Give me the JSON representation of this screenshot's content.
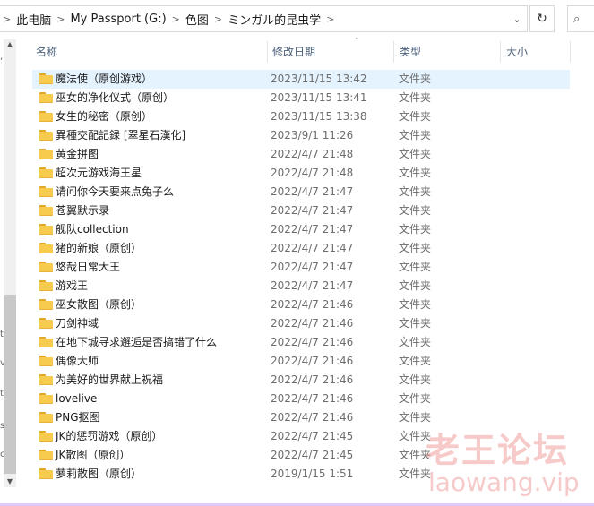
{
  "address_bar": {
    "crumbs": [
      "此电脑",
      "My Passport (G:)",
      "色图",
      "ミンガル的昆虫学"
    ],
    "separator": ">",
    "dropdown_glyph": "⌄",
    "refresh_glyph": "↻",
    "search_glyph": "⌕"
  },
  "columns": {
    "name": "名称",
    "date": "修改日期",
    "type": "类型",
    "size": "大小",
    "sort_glyph": "ˇ"
  },
  "files": [
    {
      "name": "魔法使（原创游戏）",
      "date": "2023/11/15 13:42",
      "type": "文件夹"
    },
    {
      "name": "巫女的净化仪式（原创）",
      "date": "2023/11/15 13:41",
      "type": "文件夹"
    },
    {
      "name": "女生的秘密（原创）",
      "date": "2023/11/15 13:38",
      "type": "文件夹"
    },
    {
      "name": "異種交配記録 [翠星石漢化]",
      "date": "2023/9/1 11:26",
      "type": "文件夹"
    },
    {
      "name": "黄金拼图",
      "date": "2022/4/7 21:48",
      "type": "文件夹"
    },
    {
      "name": "超次元游戏海王星",
      "date": "2022/4/7 21:48",
      "type": "文件夹"
    },
    {
      "name": "请问你今天要来点兔子么",
      "date": "2022/4/7 21:47",
      "type": "文件夹"
    },
    {
      "name": "苍翼默示录",
      "date": "2022/4/7 21:47",
      "type": "文件夹"
    },
    {
      "name": "舰队collection",
      "date": "2022/4/7 21:47",
      "type": "文件夹"
    },
    {
      "name": "猪的新娘（原创）",
      "date": "2022/4/7 21:47",
      "type": "文件夹"
    },
    {
      "name": "悠哉日常大王",
      "date": "2022/4/7 21:47",
      "type": "文件夹"
    },
    {
      "name": "游戏王",
      "date": "2022/4/7 21:47",
      "type": "文件夹"
    },
    {
      "name": "巫女散图（原创）",
      "date": "2022/4/7 21:46",
      "type": "文件夹"
    },
    {
      "name": "刀剑神域",
      "date": "2022/4/7 21:46",
      "type": "文件夹"
    },
    {
      "name": "在地下城寻求邂逅是否搞错了什么",
      "date": "2022/4/7 21:46",
      "type": "文件夹"
    },
    {
      "name": "偶像大师",
      "date": "2022/4/7 21:46",
      "type": "文件夹"
    },
    {
      "name": "为美好的世界献上祝福",
      "date": "2022/4/7 21:46",
      "type": "文件夹"
    },
    {
      "name": "lovelive",
      "date": "2022/4/7 21:46",
      "type": "文件夹"
    },
    {
      "name": "PNG抠图",
      "date": "2022/4/7 21:46",
      "type": "文件夹"
    },
    {
      "name": "JK的惩罚游戏（原创）",
      "date": "2022/4/7 21:45",
      "type": "文件夹"
    },
    {
      "name": "JK散图（原创）",
      "date": "2022/4/7 21:45",
      "type": "文件夹"
    },
    {
      "name": "萝莉散图（原创）",
      "date": "2019/1/15 1:51",
      "type": "文件夹"
    }
  ],
  "selected_index": 0,
  "watermark": {
    "line1": "老王论坛",
    "line2": "laowang.vip"
  },
  "colors": {
    "selection": "#e5f3ff",
    "folder": "#f7cb4d",
    "header_text": "#4c607a",
    "watermark": "#e86666"
  }
}
